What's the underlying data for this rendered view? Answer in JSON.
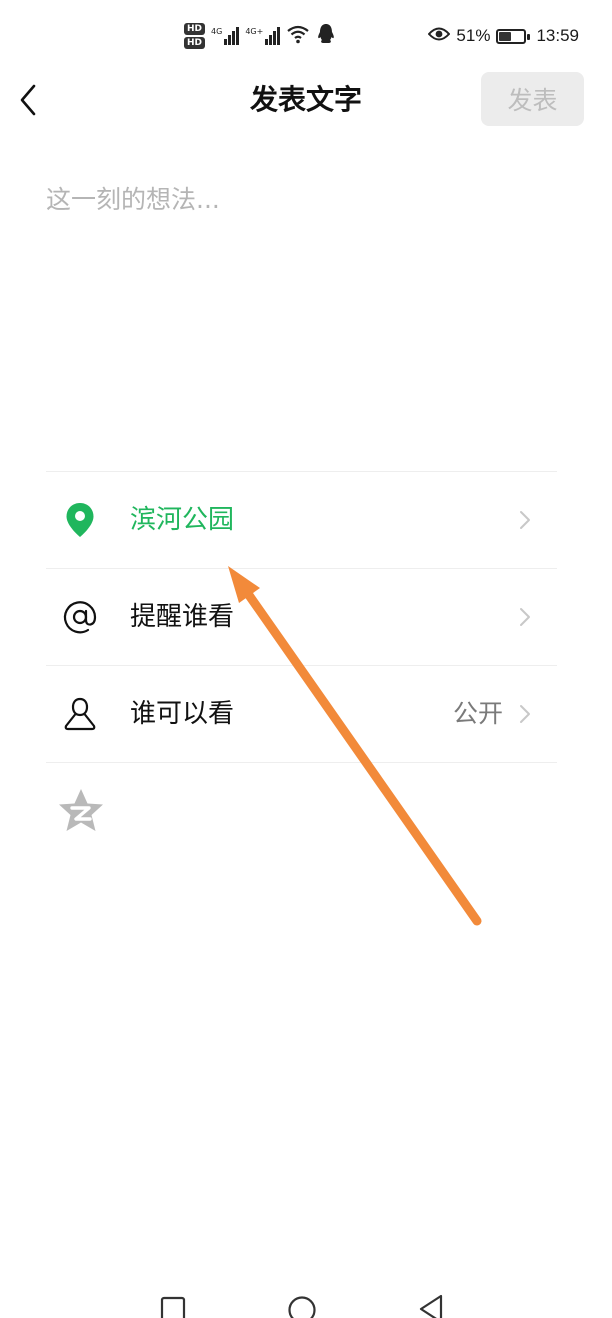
{
  "status_bar": {
    "hd_top": "HD",
    "hd_bottom": "HD",
    "sim1_network": "4G",
    "sim2_network": "4G+",
    "battery_percent": "51%",
    "battery_level": 0.51,
    "time": "13:59",
    "icons": [
      "hd-icon",
      "signal-icon",
      "wifi-icon",
      "qq-notification-icon",
      "eye-icon",
      "battery-icon"
    ]
  },
  "header": {
    "back_icon": "chevron-left-icon",
    "title": "发表文字",
    "publish_label": "发表"
  },
  "composer": {
    "placeholder": "这一刻的想法...",
    "value": ""
  },
  "options": {
    "location": {
      "icon": "location-pin-icon",
      "label": "滨河公园",
      "color": "#20b65d"
    },
    "mention": {
      "icon": "at-icon",
      "label": "提醒谁看"
    },
    "visibility": {
      "icon": "person-icon",
      "label": "谁可以看",
      "value": "公开"
    },
    "share": {
      "icon": "qzone-star-icon"
    }
  },
  "annotation": {
    "color": "#f28a3a"
  },
  "system_nav": {
    "icons": [
      "recents-icon",
      "home-icon",
      "back-icon"
    ]
  },
  "colors": {
    "accent_green": "#20b65d",
    "disabled_button_bg": "#ececec",
    "disabled_button_text": "#bdbdbd"
  }
}
